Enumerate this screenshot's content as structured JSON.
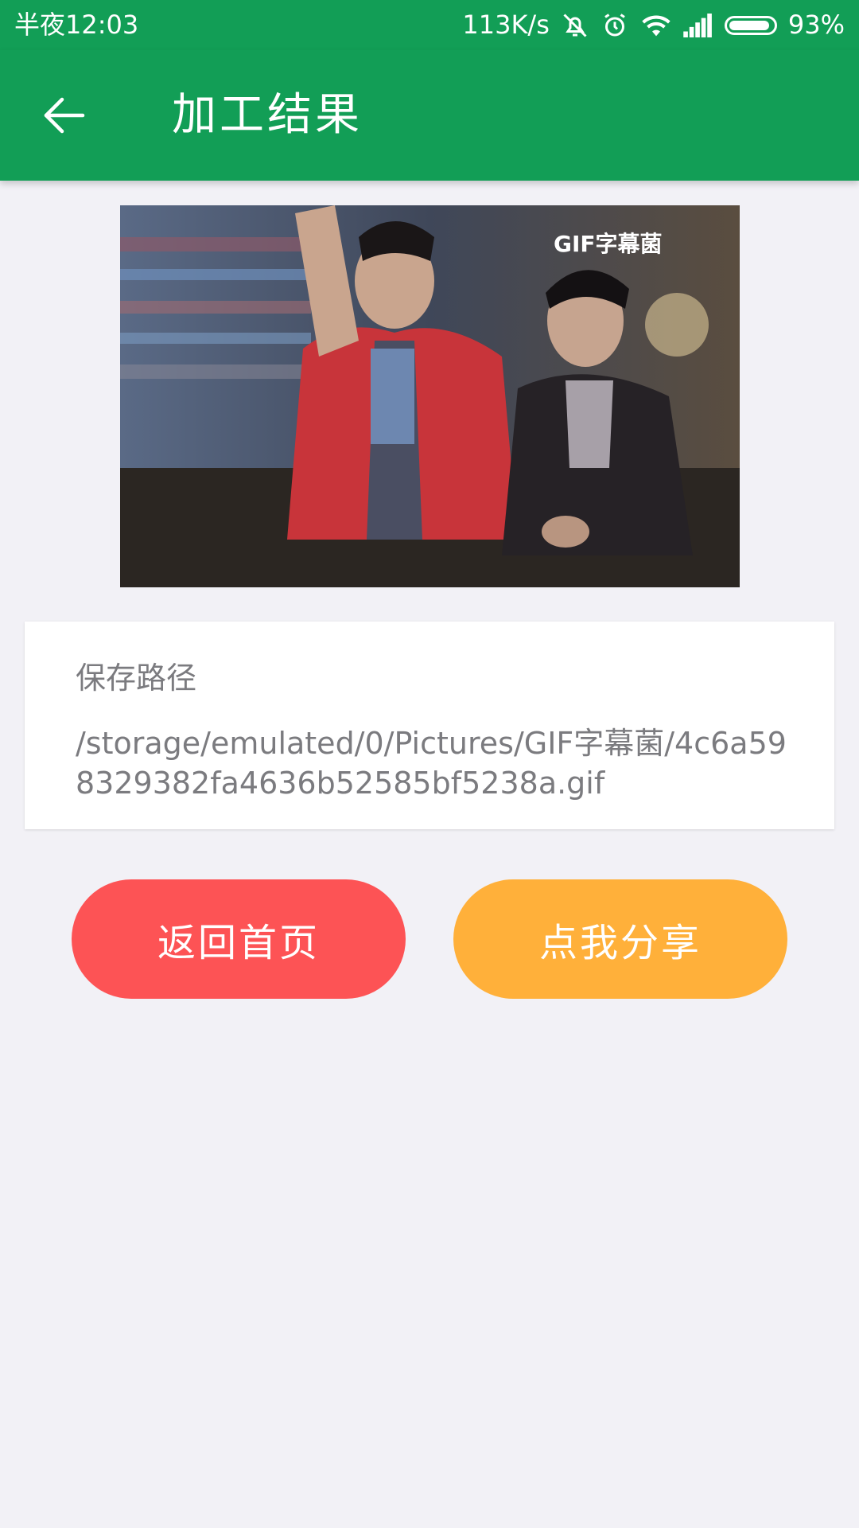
{
  "status_bar": {
    "time": "半夜12:03",
    "network_speed": "113K/s",
    "battery_percent": "93%",
    "battery_level": 0.93,
    "icons": [
      "mute-icon",
      "alarm-icon",
      "wifi-icon",
      "signal-icon",
      "battery-icon"
    ]
  },
  "app_bar": {
    "title": "加工结果",
    "back_icon": "back-arrow-icon",
    "background_color": "#129e56"
  },
  "preview": {
    "watermark": "GIF字幕菌"
  },
  "save_path": {
    "label": "保存路径",
    "value": "/storage/emulated/0/Pictures/GIF字幕菌/4c6a598329382fa4636b52585bf5238a.gif"
  },
  "actions": {
    "home_label": "返回首页",
    "home_color": "#fd5355",
    "share_label": "点我分享",
    "share_color": "#ffb03a"
  }
}
